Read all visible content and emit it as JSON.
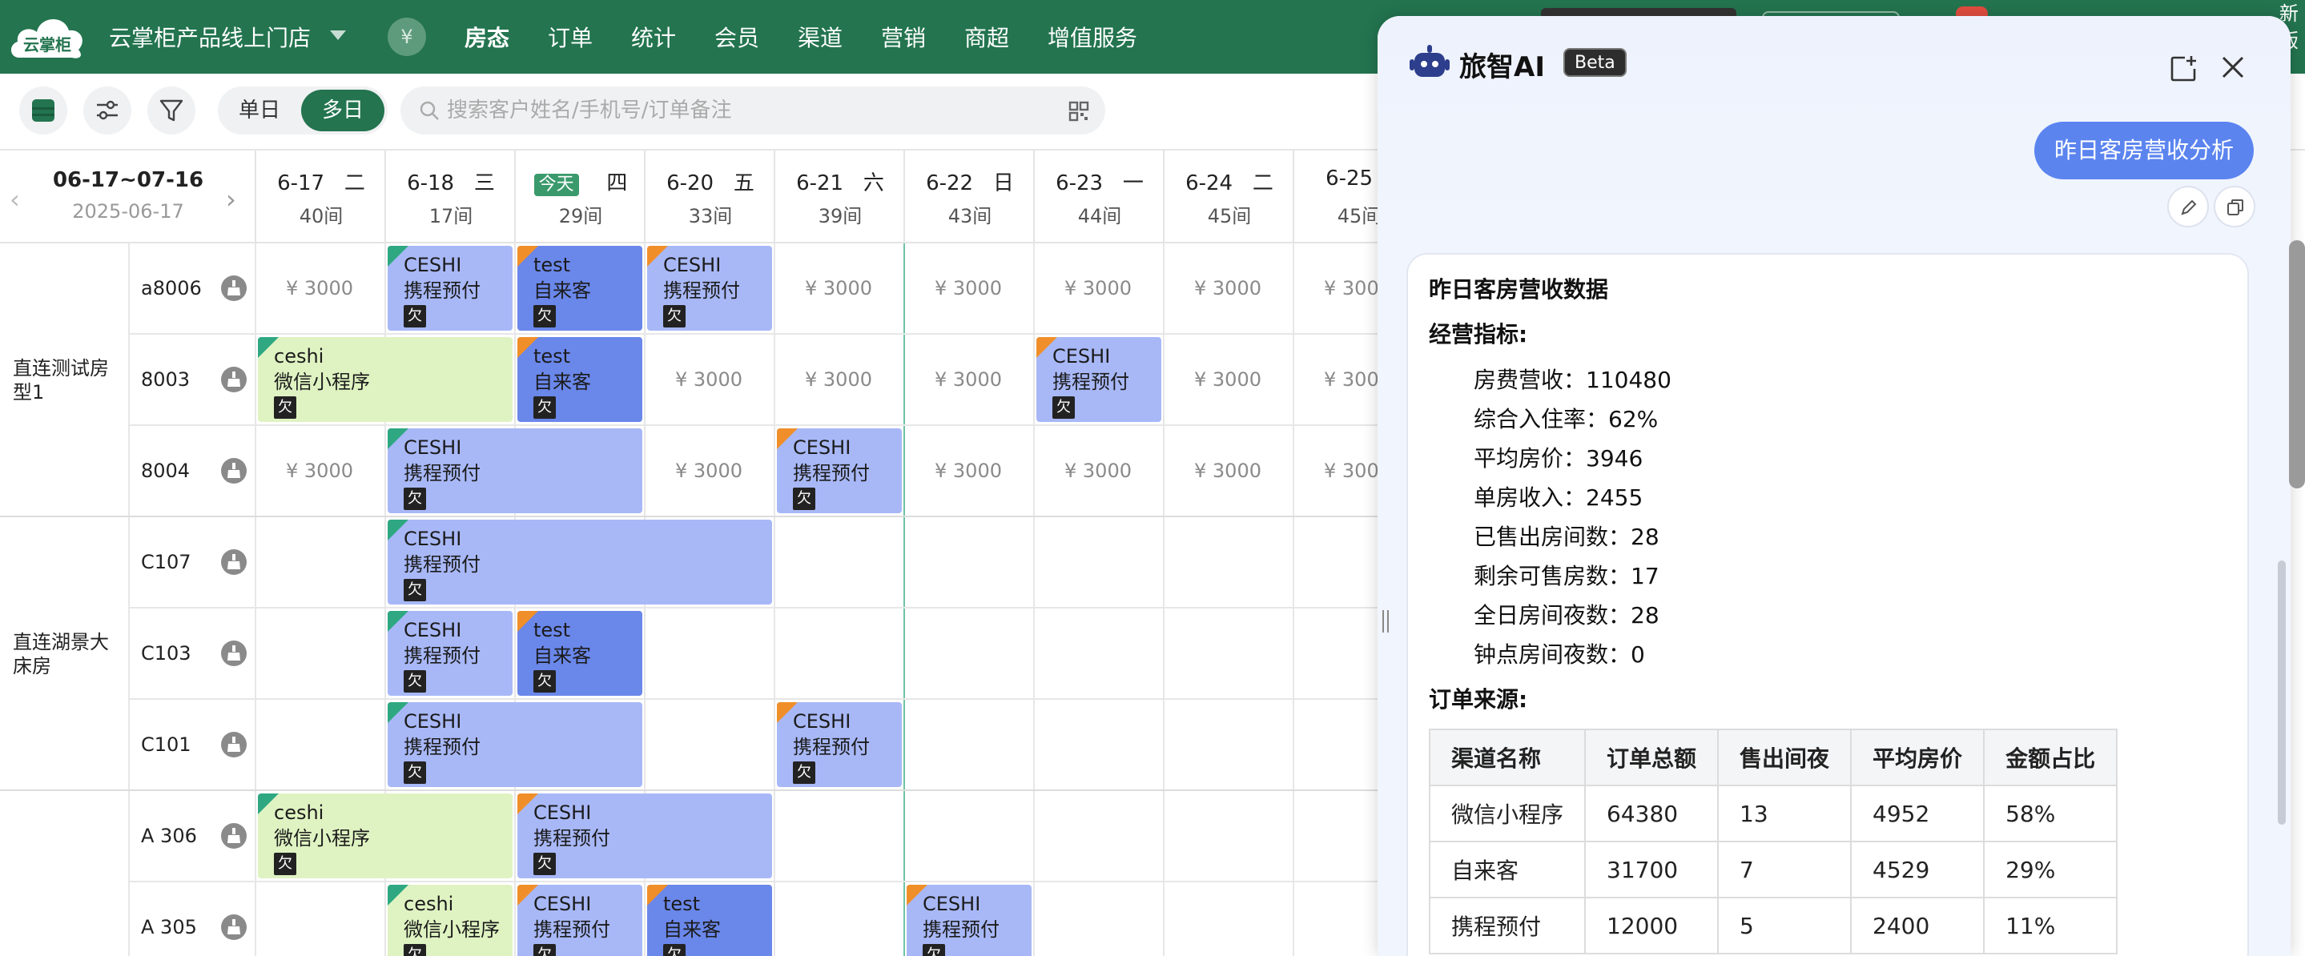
{
  "topbar": {
    "logo_text": "云掌柜",
    "hotel_name": "云掌柜产品线上门店",
    "yen_badge": "¥",
    "nav": [
      "房态",
      "订单",
      "统计",
      "会员",
      "渠道",
      "营销",
      "商超",
      "增值服务"
    ],
    "active_nav": "房态",
    "new_tag": "新版"
  },
  "toolbar": {
    "view_single": "单日",
    "view_multi": "多日",
    "search_placeholder": "搜索客户姓名/手机号/订单备注"
  },
  "calendar": {
    "range": "06-17~07-16",
    "current_date": "2025-06-17",
    "today_label": "今天",
    "days": [
      {
        "date": "6-17",
        "weekday": "二",
        "rooms": "40间",
        "today": false
      },
      {
        "date": "6-18",
        "weekday": "三",
        "rooms": "17间",
        "today": false
      },
      {
        "date": "",
        "weekday": "四",
        "rooms": "29间",
        "today": true
      },
      {
        "date": "6-20",
        "weekday": "五",
        "rooms": "33间",
        "today": false
      },
      {
        "date": "6-21",
        "weekday": "六",
        "rooms": "39间",
        "today": false
      },
      {
        "date": "6-22",
        "weekday": "日",
        "rooms": "43间",
        "today": false
      },
      {
        "date": "6-23",
        "weekday": "一",
        "rooms": "44间",
        "today": false
      },
      {
        "date": "6-24",
        "weekday": "二",
        "rooms": "45间",
        "today": false
      },
      {
        "date": "6-25",
        "weekday": "",
        "rooms": "45间",
        "today": false
      }
    ],
    "room_types": [
      {
        "name": "直连测试房型1",
        "rooms": [
          "a8006",
          "8003",
          "8004"
        ]
      },
      {
        "name": "直连湖景大床房",
        "rooms": [
          "C107",
          "C103",
          "C101"
        ]
      },
      {
        "name": "",
        "rooms": [
          "A 306",
          "A 305"
        ]
      }
    ],
    "price_text": "¥ 3000",
    "owe_text": "欠",
    "bookings": [
      {
        "room": 0,
        "start": 1,
        "span": 1,
        "name": "CESHI",
        "channel": "携程预付",
        "color": "purple",
        "corner": "teal"
      },
      {
        "room": 0,
        "start": 2,
        "span": 1,
        "name": "test",
        "channel": "自来客",
        "color": "blue",
        "corner": "orange"
      },
      {
        "room": 0,
        "start": 3,
        "span": 1,
        "name": "CESHI",
        "channel": "携程预付",
        "color": "purple",
        "corner": "orange"
      },
      {
        "room": 1,
        "start": 0,
        "span": 2,
        "name": "ceshi",
        "channel": "微信小程序",
        "color": "green",
        "corner": "teal"
      },
      {
        "room": 1,
        "start": 2,
        "span": 1,
        "name": "test",
        "channel": "自来客",
        "color": "blue",
        "corner": "orange"
      },
      {
        "room": 1,
        "start": 6,
        "span": 1,
        "name": "CESHI",
        "channel": "携程预付",
        "color": "purple",
        "corner": "orange"
      },
      {
        "room": 2,
        "start": 1,
        "span": 2,
        "name": "CESHI",
        "channel": "携程预付",
        "color": "purple",
        "corner": "teal"
      },
      {
        "room": 2,
        "start": 4,
        "span": 1,
        "name": "CESHI",
        "channel": "携程预付",
        "color": "purple",
        "corner": "orange"
      },
      {
        "room": 3,
        "start": 1,
        "span": 3,
        "name": "CESHI",
        "channel": "携程预付",
        "color": "purple",
        "corner": "teal"
      },
      {
        "room": 4,
        "start": 1,
        "span": 1,
        "name": "CESHI",
        "channel": "携程预付",
        "color": "purple",
        "corner": "teal"
      },
      {
        "room": 4,
        "start": 2,
        "span": 1,
        "name": "test",
        "channel": "自来客",
        "color": "blue",
        "corner": "orange"
      },
      {
        "room": 5,
        "start": 1,
        "span": 2,
        "name": "CESHI",
        "channel": "携程预付",
        "color": "purple",
        "corner": "teal"
      },
      {
        "room": 5,
        "start": 4,
        "span": 1,
        "name": "CESHI",
        "channel": "携程预付",
        "color": "purple",
        "corner": "orange"
      },
      {
        "room": 6,
        "start": 0,
        "span": 2,
        "name": "ceshi",
        "channel": "微信小程序",
        "color": "green",
        "corner": "teal"
      },
      {
        "room": 6,
        "start": 2,
        "span": 2,
        "name": "CESHI",
        "channel": "携程预付",
        "color": "purple",
        "corner": "orange"
      },
      {
        "room": 7,
        "start": 1,
        "span": 1,
        "name": "ceshi",
        "channel": "微信小程序",
        "color": "green",
        "corner": "teal"
      },
      {
        "room": 7,
        "start": 2,
        "span": 1,
        "name": "CESHI",
        "channel": "携程预付",
        "color": "purple",
        "corner": "orange"
      },
      {
        "room": 7,
        "start": 3,
        "span": 1,
        "name": "test",
        "channel": "自来客",
        "color": "blue",
        "corner": "orange"
      },
      {
        "room": 7,
        "start": 5,
        "span": 1,
        "name": "CESHI",
        "channel": "携程预付",
        "color": "purple",
        "corner": "orange"
      }
    ],
    "prices": [
      {
        "room": 0,
        "days": [
          0,
          4,
          5,
          6,
          7,
          8
        ]
      },
      {
        "room": 1,
        "days": [
          3,
          4,
          5,
          7,
          8
        ]
      },
      {
        "room": 2,
        "days": [
          0,
          3,
          5,
          6,
          7,
          8
        ]
      }
    ]
  },
  "ai_panel": {
    "title": "旅智AI",
    "beta": "Beta",
    "user_message": "昨日客房营收分析",
    "answer_title": "昨日客房营收数据",
    "section_metrics": "经营指标:",
    "metrics": [
      "房费营收：110480",
      "综合入住率：62%",
      "平均房价：3946",
      "单房收入：2455",
      "已售出房间数：28",
      "剩余可售房数：17",
      "全日房间夜数：28",
      "钟点房间夜数：0"
    ],
    "section_orders": "订单来源:",
    "table_headers": [
      "渠道名称",
      "订单总额",
      "售出间夜",
      "平均房价",
      "金额占比"
    ],
    "table_rows": [
      [
        "微信小程序",
        "64380",
        "13",
        "4952",
        "58%"
      ],
      [
        "自来客",
        "31700",
        "7",
        "4529",
        "29%"
      ],
      [
        "携程预付",
        "12000",
        "5",
        "2400",
        "11%"
      ]
    ]
  },
  "colors": {
    "brand_green": "#23744f",
    "booking_purple": "#a8b8f7",
    "booking_blue": "#6a87ea",
    "booking_green": "#dff3c2",
    "corner_orange": "#f08f2a",
    "corner_teal": "#2fa882",
    "ai_bubble": "#5b84ef"
  }
}
